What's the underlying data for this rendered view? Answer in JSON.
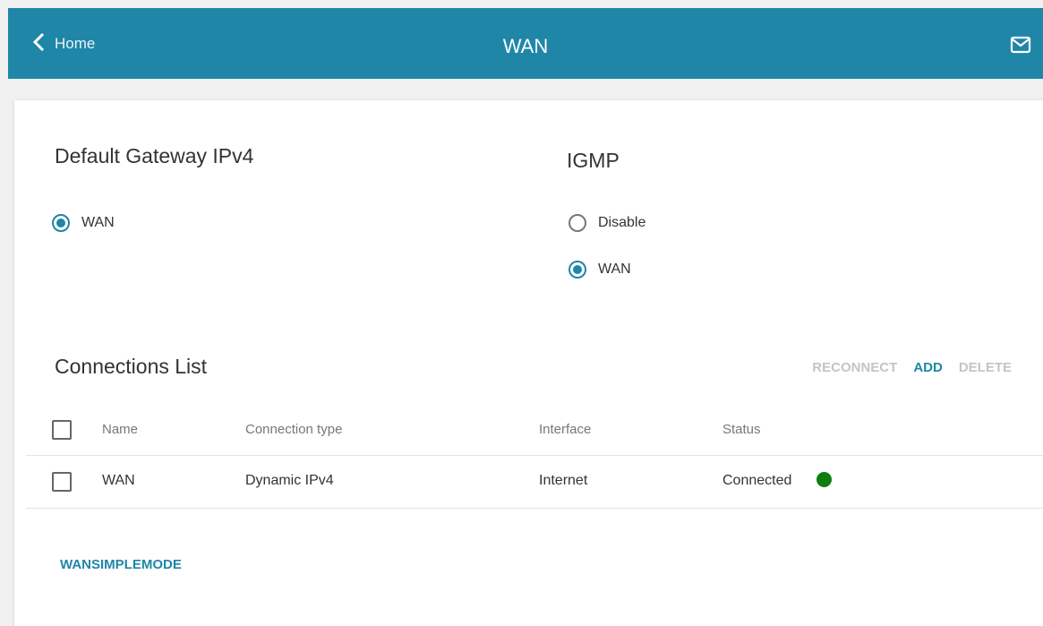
{
  "header": {
    "back_label": "Home",
    "title": "WAN",
    "back_icon": "chevron-left-icon",
    "mail_icon": "envelope-icon"
  },
  "gateway": {
    "title": "Default Gateway IPv4",
    "options": [
      {
        "label": "WAN",
        "checked": true
      }
    ]
  },
  "igmp": {
    "title": "IGMP",
    "options": [
      {
        "label": "Disable",
        "checked": false
      },
      {
        "label": "WAN",
        "checked": true
      }
    ]
  },
  "connections": {
    "title": "Connections List",
    "actions": {
      "reconnect": "RECONNECT",
      "add": "ADD",
      "delete": "DELETE"
    },
    "columns": [
      "Name",
      "Connection type",
      "Interface",
      "Status"
    ],
    "rows": [
      {
        "name": "WAN",
        "type": "Dynamic IPv4",
        "interface": "Internet",
        "status": "Connected",
        "status_color": "#0f7d0f"
      }
    ]
  },
  "wansimplemode_label": "WANSIMPLEMODE",
  "colors": {
    "accent": "#1f86a8",
    "disabled": "#c4c4c4",
    "connected": "#0f7d0f"
  }
}
